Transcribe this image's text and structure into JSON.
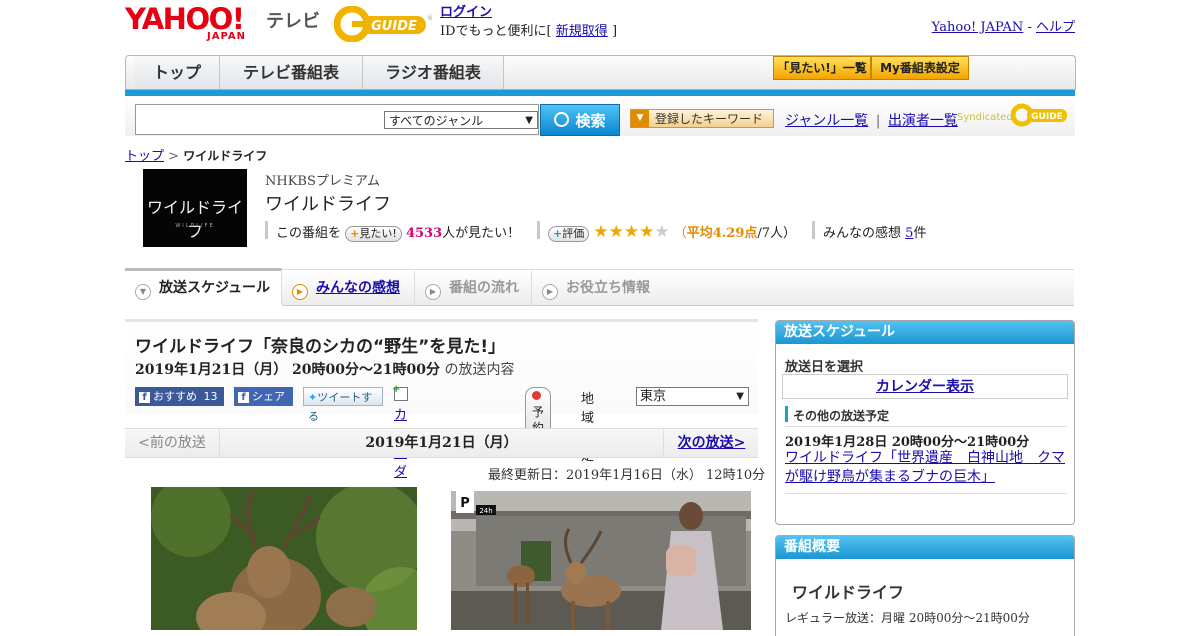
{
  "header": {
    "yahoo_logo": "YAHOO!",
    "yahoo_japan": "JAPAN",
    "tv_label": "テレビ",
    "gguide_logo": "G-GUIDE",
    "login": "ログイン",
    "login_sub_prefix": "IDでもっと便利に[",
    "signup": "新規取得",
    "login_sub_suffix": "]",
    "yahoo_japan_link": "Yahoo! JAPAN",
    "sep": "-",
    "help": "ヘルプ"
  },
  "nav": {
    "tabs": [
      "トップ",
      "テレビ番組表",
      "ラジオ番組表"
    ],
    "mitai_list": "「見たい!」一覧",
    "my_schedule": "My番組表設定"
  },
  "search": {
    "genre_select": "すべてのジャンル",
    "search_button": "検索",
    "keyword_button": "登録したキーワード",
    "genre_list": "ジャンル一覧",
    "divider": "|",
    "performer_list": "出演者一覧",
    "syndicated": "Syndicated"
  },
  "breadcrumb": {
    "home": "トップ",
    "sep": ">",
    "current": "ワイルドライフ"
  },
  "program": {
    "thumb_title": "ワイルドライフ",
    "thumb_sub": "WILDLIFE",
    "channel": "NHKBSプレミアム",
    "title": "ワイルドライフ",
    "mitai_prefix": "この番組を",
    "mitai_button": "見たい!",
    "mitai_count": "4533",
    "mitai_suffix": "人が見たい！",
    "rate_button": "評価",
    "stars": "★★★★",
    "stars_empty": "★",
    "rating_open": "（",
    "rating_avg": "平均4.29点",
    "rating_count": "/7人）",
    "rating_value": 4.29,
    "reviews_label": "みんなの感想",
    "reviews_count": "5",
    "reviews_suffix": "件"
  },
  "tabs": [
    {
      "label": "放送スケジュール"
    },
    {
      "label": "みんなの感想"
    },
    {
      "label": "番組の流れ"
    },
    {
      "label": "お役立ち情報"
    }
  ],
  "episode": {
    "title": "ワイルドライフ「奈良のシカの“野生”を見た!」",
    "date": "2019年1月21日（月）  20時00分～21時00分",
    "date_suffix": "の放送内容",
    "recommend": "おすすめ",
    "recommend_count": "13",
    "share": "シェア",
    "tweet": "ツイートする",
    "calendar": "カレンダーに登録",
    "reserve": "予約",
    "region_label": "地域設定",
    "region_value": "東京",
    "prev": "<前の放送",
    "current_date": "2019年1月21日（月）",
    "next": "次の放送>",
    "updated": "最終更新日：2019年1月16日（水）  12時10分",
    "photo2_sign1": "P",
    "photo2_sign2": "24h"
  },
  "schedule_panel": {
    "header": "放送スケジュール",
    "select_label": "放送日を選択",
    "calendar_link": "カレンダー表示",
    "other_label": "その他の放送予定",
    "other_date": "2019年1月28日  20時00分～21時00分",
    "other_title": "ワイルドライフ「世界遺産　白神山地　クマが駆け野鳥が集まるブナの巨木」"
  },
  "summary_panel": {
    "header": "番組概要",
    "title": "ワイルドライフ",
    "regular": "レギュラー放送：月曜 20時00分～21時00分"
  },
  "colors": {
    "yahoo_red": "#e60012",
    "accent_blue": "#1e9ad6",
    "link": "#1a0dab",
    "pink_count": "#d6006f",
    "star_gold": "#f0a800"
  }
}
